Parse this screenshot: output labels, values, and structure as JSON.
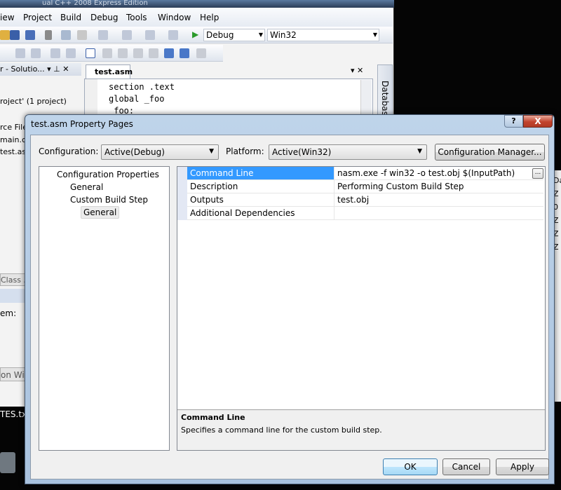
{
  "ide": {
    "title": "ual C++ 2008 Express Edition",
    "menu": [
      "iew",
      "Project",
      "Build",
      "Debug",
      "Tools",
      "Window",
      "Help"
    ],
    "toolbar": {
      "config": "Debug",
      "platform": "Win32"
    },
    "solution_explorer": {
      "header": "r - Solutio...",
      "root": "roject' (1 project)",
      "items": [
        "rce File",
        "main.c",
        "test.asn"
      ]
    },
    "class_tab": "Class ...",
    "properties_label": "em:",
    "output_tab": "on Win",
    "editor": {
      "tab": "test.asm",
      "lines": [
        "section .text",
        "global _foo",
        " foo:"
      ]
    },
    "side_tab": "Databas"
  },
  "desktop": {
    "file_label": "TES.txt"
  },
  "right_window": {
    "lines": [
      "Da",
      "Z",
      "0",
      "Z",
      "Z",
      "Z"
    ]
  },
  "dialog": {
    "title": "test.asm Property Pages",
    "help": "?",
    "close": "X",
    "configuration_label": "Configuration:",
    "configuration_value": "Active(Debug)",
    "platform_label": "Platform:",
    "platform_value": "Active(Win32)",
    "config_manager": "Configuration Manager...",
    "tree": [
      "Configuration Properties",
      "General",
      "Custom Build Step",
      "General"
    ],
    "properties": [
      {
        "name": "Command Line",
        "value": "nasm.exe -f win32 -o test.obj $(InputPath)"
      },
      {
        "name": "Description",
        "value": "Performing Custom Build Step"
      },
      {
        "name": "Outputs",
        "value": "test.obj"
      },
      {
        "name": "Additional Dependencies",
        "value": ""
      }
    ],
    "ellipsis": "...",
    "description_title": "Command Line",
    "description_text": "Specifies a command line for the custom build step.",
    "buttons": {
      "ok": "OK",
      "cancel": "Cancel",
      "apply": "Apply"
    }
  }
}
